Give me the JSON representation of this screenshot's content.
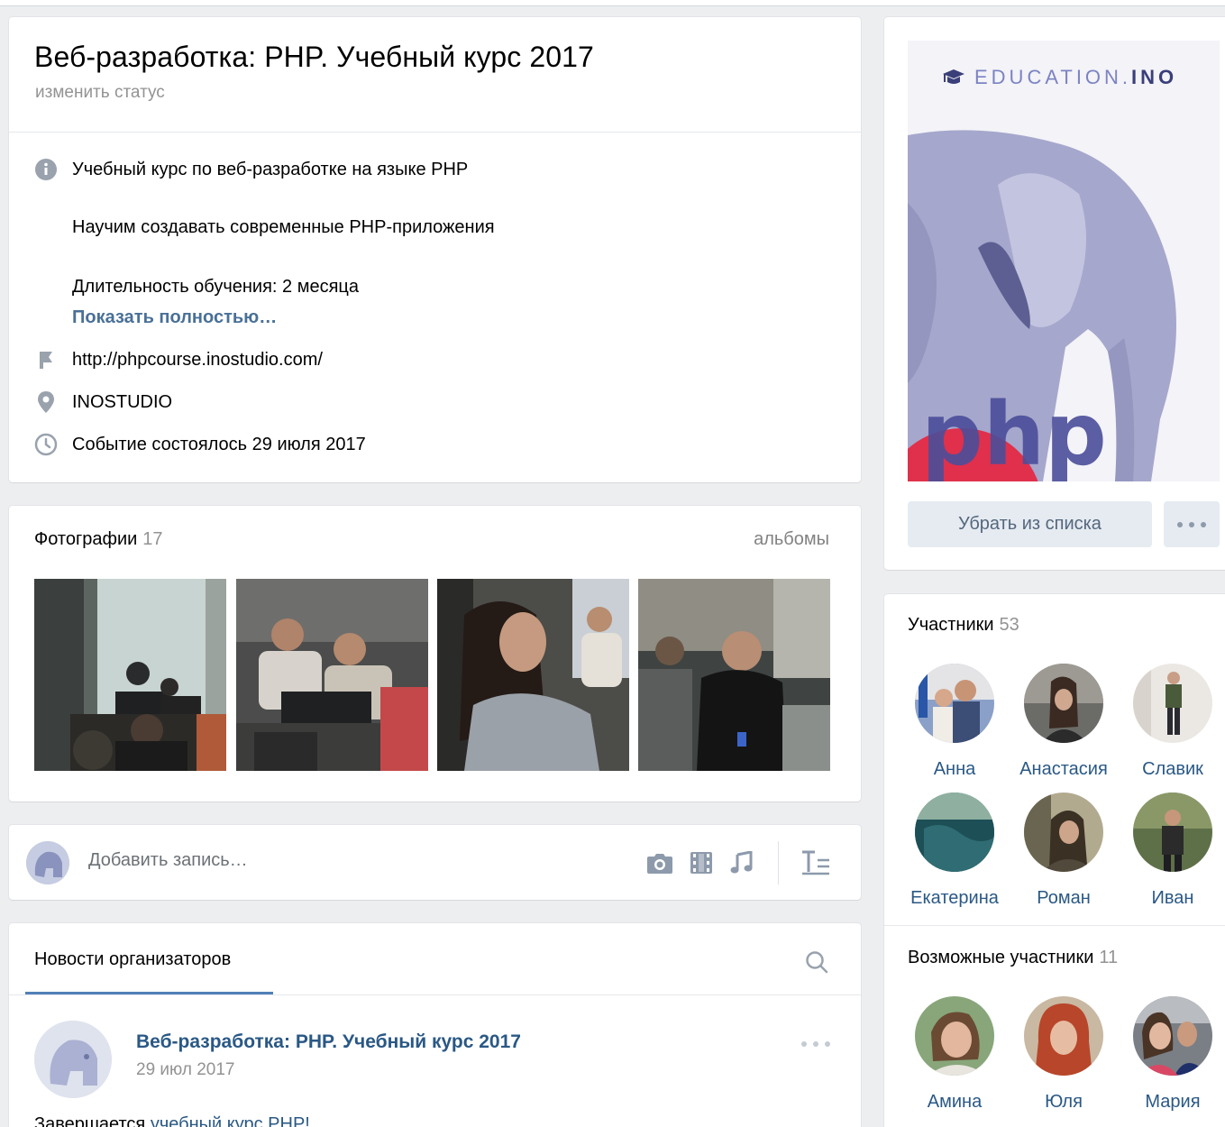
{
  "header": {
    "title": "Веб-разработка: PHP. Учебный курс 2017",
    "status": "изменить статус",
    "description_line1": "Учебный курс по веб-разработке на языке PHP",
    "description_line2": "Научим создавать современные PHP-приложения",
    "description_line3": "Длительность обучения: 2 месяца",
    "show_more": "Показать полностью…",
    "website": "http://phpcourse.inostudio.com/",
    "location": "INOSTUDIO",
    "event_date": "Событие состоялось 29 июля 2017"
  },
  "photos": {
    "title": "Фотографии",
    "count": "17",
    "albums_link": "альбомы"
  },
  "postbox": {
    "placeholder": "Добавить запись…"
  },
  "news": {
    "tab": "Новости организаторов",
    "author": "Веб-разработка: PHP. Учебный курс 2017",
    "date": "29 июл 2017",
    "text_start": "Завершается ",
    "text_link": "учебный курс PHP!"
  },
  "cover": {
    "logo_text": "EDUCATION.",
    "logo_bold": "INO",
    "cover_word": "php",
    "remove_button": "Убрать из списка"
  },
  "members": {
    "title": "Участники",
    "count": "53",
    "list": [
      "Анна",
      "Анастасия",
      "Славик",
      "Екатерина",
      "Роман",
      "Иван"
    ]
  },
  "possible_members": {
    "title": "Возможные участники",
    "count": "11",
    "list": [
      "Амина",
      "Юля",
      "Мария"
    ]
  },
  "colors": {
    "accent": "#5181b8",
    "link": "#2a5885",
    "muted": "#939393",
    "background": "#edeef0"
  }
}
